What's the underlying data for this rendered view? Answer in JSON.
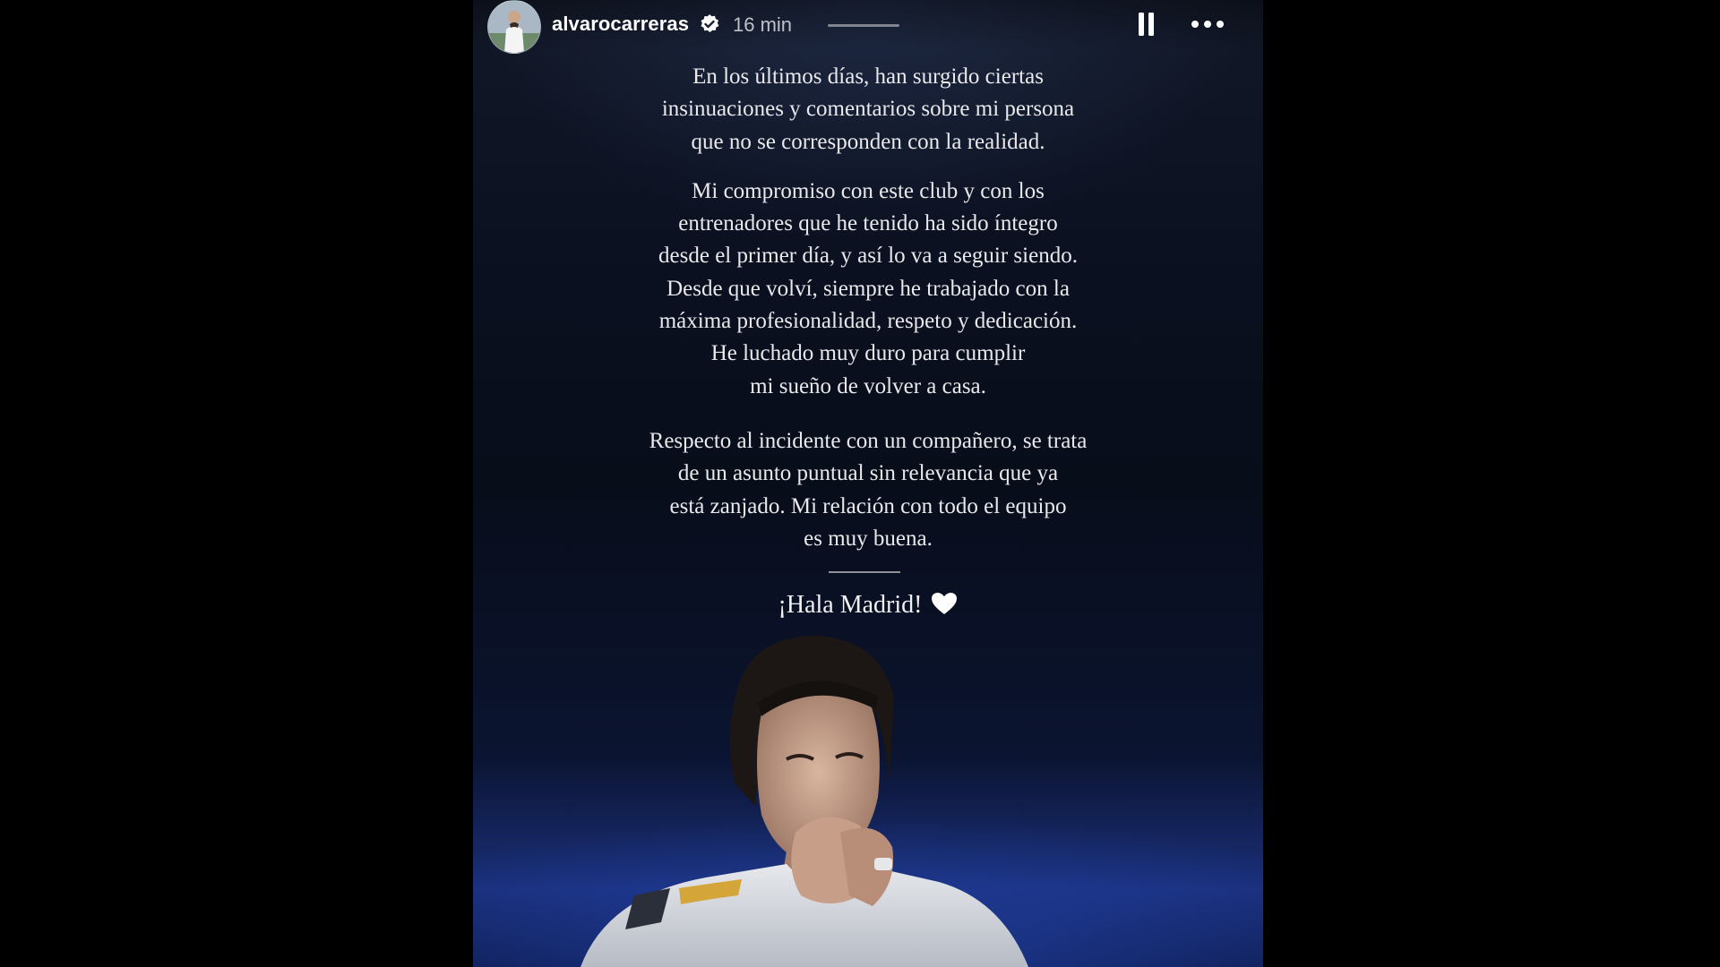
{
  "header": {
    "username": "alvarocarreras",
    "timestamp": "16 min",
    "verified_icon": "verified-badge-icon",
    "pause_icon": "pause-icon",
    "more_icon": "more-options-icon"
  },
  "message": {
    "paragraph1": [
      "En los últimos días, han surgido ciertas",
      "insinuaciones y comentarios sobre mi persona",
      "que no se corresponden con la realidad."
    ],
    "paragraph2": [
      "Mi compromiso con este club y con los",
      "entrenadores que he tenido ha sido íntegro",
      "desde el primer día, y así lo va a seguir siendo.",
      "Desde que volví, siempre he trabajado con la",
      "máxima profesionalidad, respeto y dedicación.",
      "He luchado muy duro para cumplir",
      "mi sueño de volver a casa."
    ],
    "paragraph3": [
      "Respecto al incidente con un compañero, se trata",
      "de un asunto puntual sin relevancia que ya",
      "está zanjado. Mi relación con todo el equipo",
      "es muy buena."
    ],
    "closing": "¡Hala Madrid!",
    "closing_icon": "white-heart-icon"
  },
  "colors": {
    "background": "#000000",
    "story_top": "#121827",
    "story_bottom": "#1a2f7a",
    "text": "#e9e9ec"
  }
}
